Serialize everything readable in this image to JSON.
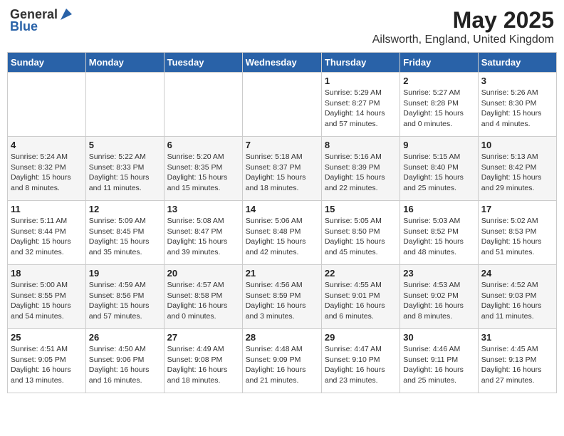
{
  "header": {
    "logo_general": "General",
    "logo_blue": "Blue",
    "title": "May 2025",
    "subtitle": "Ailsworth, England, United Kingdom"
  },
  "columns": [
    "Sunday",
    "Monday",
    "Tuesday",
    "Wednesday",
    "Thursday",
    "Friday",
    "Saturday"
  ],
  "rows": [
    [
      {
        "day": "",
        "info": ""
      },
      {
        "day": "",
        "info": ""
      },
      {
        "day": "",
        "info": ""
      },
      {
        "day": "",
        "info": ""
      },
      {
        "day": "1",
        "info": "Sunrise: 5:29 AM\nSunset: 8:27 PM\nDaylight: 14 hours and 57 minutes."
      },
      {
        "day": "2",
        "info": "Sunrise: 5:27 AM\nSunset: 8:28 PM\nDaylight: 15 hours and 0 minutes."
      },
      {
        "day": "3",
        "info": "Sunrise: 5:26 AM\nSunset: 8:30 PM\nDaylight: 15 hours and 4 minutes."
      }
    ],
    [
      {
        "day": "4",
        "info": "Sunrise: 5:24 AM\nSunset: 8:32 PM\nDaylight: 15 hours and 8 minutes."
      },
      {
        "day": "5",
        "info": "Sunrise: 5:22 AM\nSunset: 8:33 PM\nDaylight: 15 hours and 11 minutes."
      },
      {
        "day": "6",
        "info": "Sunrise: 5:20 AM\nSunset: 8:35 PM\nDaylight: 15 hours and 15 minutes."
      },
      {
        "day": "7",
        "info": "Sunrise: 5:18 AM\nSunset: 8:37 PM\nDaylight: 15 hours and 18 minutes."
      },
      {
        "day": "8",
        "info": "Sunrise: 5:16 AM\nSunset: 8:39 PM\nDaylight: 15 hours and 22 minutes."
      },
      {
        "day": "9",
        "info": "Sunrise: 5:15 AM\nSunset: 8:40 PM\nDaylight: 15 hours and 25 minutes."
      },
      {
        "day": "10",
        "info": "Sunrise: 5:13 AM\nSunset: 8:42 PM\nDaylight: 15 hours and 29 minutes."
      }
    ],
    [
      {
        "day": "11",
        "info": "Sunrise: 5:11 AM\nSunset: 8:44 PM\nDaylight: 15 hours and 32 minutes."
      },
      {
        "day": "12",
        "info": "Sunrise: 5:09 AM\nSunset: 8:45 PM\nDaylight: 15 hours and 35 minutes."
      },
      {
        "day": "13",
        "info": "Sunrise: 5:08 AM\nSunset: 8:47 PM\nDaylight: 15 hours and 39 minutes."
      },
      {
        "day": "14",
        "info": "Sunrise: 5:06 AM\nSunset: 8:48 PM\nDaylight: 15 hours and 42 minutes."
      },
      {
        "day": "15",
        "info": "Sunrise: 5:05 AM\nSunset: 8:50 PM\nDaylight: 15 hours and 45 minutes."
      },
      {
        "day": "16",
        "info": "Sunrise: 5:03 AM\nSunset: 8:52 PM\nDaylight: 15 hours and 48 minutes."
      },
      {
        "day": "17",
        "info": "Sunrise: 5:02 AM\nSunset: 8:53 PM\nDaylight: 15 hours and 51 minutes."
      }
    ],
    [
      {
        "day": "18",
        "info": "Sunrise: 5:00 AM\nSunset: 8:55 PM\nDaylight: 15 hours and 54 minutes."
      },
      {
        "day": "19",
        "info": "Sunrise: 4:59 AM\nSunset: 8:56 PM\nDaylight: 15 hours and 57 minutes."
      },
      {
        "day": "20",
        "info": "Sunrise: 4:57 AM\nSunset: 8:58 PM\nDaylight: 16 hours and 0 minutes."
      },
      {
        "day": "21",
        "info": "Sunrise: 4:56 AM\nSunset: 8:59 PM\nDaylight: 16 hours and 3 minutes."
      },
      {
        "day": "22",
        "info": "Sunrise: 4:55 AM\nSunset: 9:01 PM\nDaylight: 16 hours and 6 minutes."
      },
      {
        "day": "23",
        "info": "Sunrise: 4:53 AM\nSunset: 9:02 PM\nDaylight: 16 hours and 8 minutes."
      },
      {
        "day": "24",
        "info": "Sunrise: 4:52 AM\nSunset: 9:03 PM\nDaylight: 16 hours and 11 minutes."
      }
    ],
    [
      {
        "day": "25",
        "info": "Sunrise: 4:51 AM\nSunset: 9:05 PM\nDaylight: 16 hours and 13 minutes."
      },
      {
        "day": "26",
        "info": "Sunrise: 4:50 AM\nSunset: 9:06 PM\nDaylight: 16 hours and 16 minutes."
      },
      {
        "day": "27",
        "info": "Sunrise: 4:49 AM\nSunset: 9:08 PM\nDaylight: 16 hours and 18 minutes."
      },
      {
        "day": "28",
        "info": "Sunrise: 4:48 AM\nSunset: 9:09 PM\nDaylight: 16 hours and 21 minutes."
      },
      {
        "day": "29",
        "info": "Sunrise: 4:47 AM\nSunset: 9:10 PM\nDaylight: 16 hours and 23 minutes."
      },
      {
        "day": "30",
        "info": "Sunrise: 4:46 AM\nSunset: 9:11 PM\nDaylight: 16 hours and 25 minutes."
      },
      {
        "day": "31",
        "info": "Sunrise: 4:45 AM\nSunset: 9:13 PM\nDaylight: 16 hours and 27 minutes."
      }
    ]
  ]
}
